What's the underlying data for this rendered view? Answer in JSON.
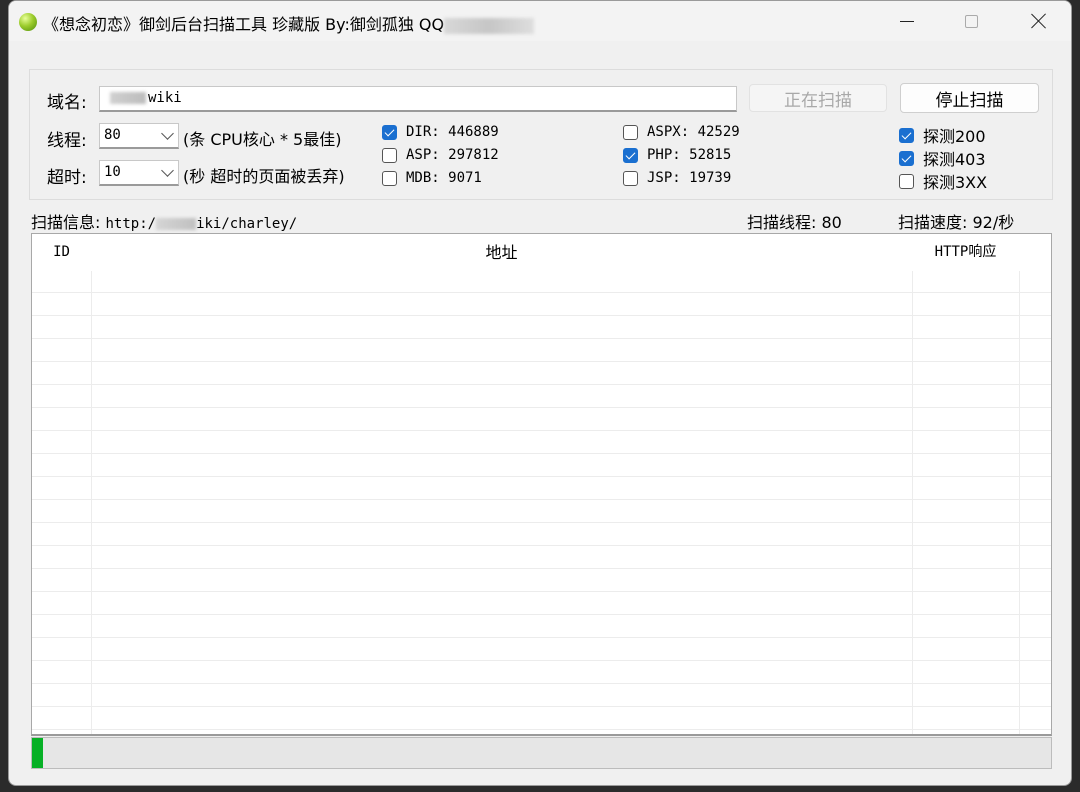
{
  "window": {
    "title": "《想念初恋》御剑后台扫描工具 珍藏版 By:御剑孤独 QQ",
    "controls": {
      "minimize": "minimize-icon",
      "maximize": "maximize-icon",
      "close": "close-icon"
    }
  },
  "form": {
    "domain_label": "域名:",
    "domain_value": "wiki",
    "scan_button_label": "正在扫描",
    "stop_button_label": "停止扫描",
    "threads_label": "线程:",
    "threads_value": "80",
    "threads_hint": "(条 CPU核心 * 5最佳)",
    "timeout_label": "超时:",
    "timeout_value": "10",
    "timeout_hint": "(秒 超时的页面被丢弃)"
  },
  "dictionaries": [
    {
      "label": "DIR: 446889",
      "checked": true
    },
    {
      "label": "ASP: 297812",
      "checked": false
    },
    {
      "label": "MDB: 9071",
      "checked": false
    },
    {
      "label": "ASPX: 42529",
      "checked": false
    },
    {
      "label": "PHP: 52815",
      "checked": true
    },
    {
      "label": "JSP: 19739",
      "checked": false
    }
  ],
  "probes": [
    {
      "label": "探测200",
      "checked": true
    },
    {
      "label": "探测403",
      "checked": true
    },
    {
      "label": "探测3XX",
      "checked": false
    }
  ],
  "status": {
    "scan_info_label": "扫描信息:",
    "scan_info_url": "iki/charley/",
    "url_prefix": "http:/",
    "threads_text": "扫描线程: 80",
    "speed_text": "扫描速度: 92/秒"
  },
  "table": {
    "columns": [
      "ID",
      "地址",
      "HTTP响应"
    ],
    "rows": []
  },
  "progress": {
    "fraction": 0.011,
    "color": "#06b025"
  }
}
